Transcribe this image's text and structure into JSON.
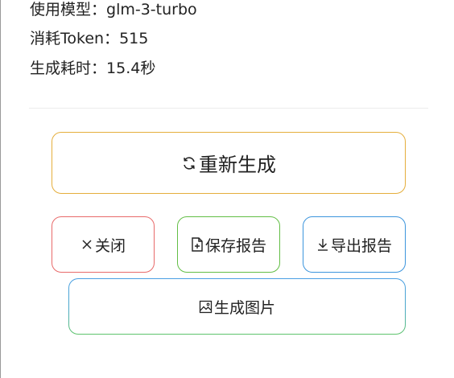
{
  "info": {
    "model_label": "使用模型：",
    "model_value": "glm-3-turbo",
    "tokens_label": "消耗Token：",
    "tokens_value": "515",
    "time_label": "生成耗时：",
    "time_value": "15.4秒"
  },
  "buttons": {
    "regenerate": "重新生成",
    "close": "关闭",
    "save_report": "保存报告",
    "export_report": "导出报告",
    "generate_image": "生成图片"
  },
  "icons": {
    "regenerate": "refresh-icon",
    "close": "close-icon",
    "save_report": "file-plus-icon",
    "export_report": "download-icon",
    "generate_image": "image-icon"
  },
  "colors": {
    "regenerate_border": "#e5ae3c",
    "close_border": "#e86a6a",
    "save_border": "#62be45",
    "export_border": "#3c95dd",
    "image_border_top": "#4a9fe4",
    "image_border_bottom": "#5ec46a"
  }
}
